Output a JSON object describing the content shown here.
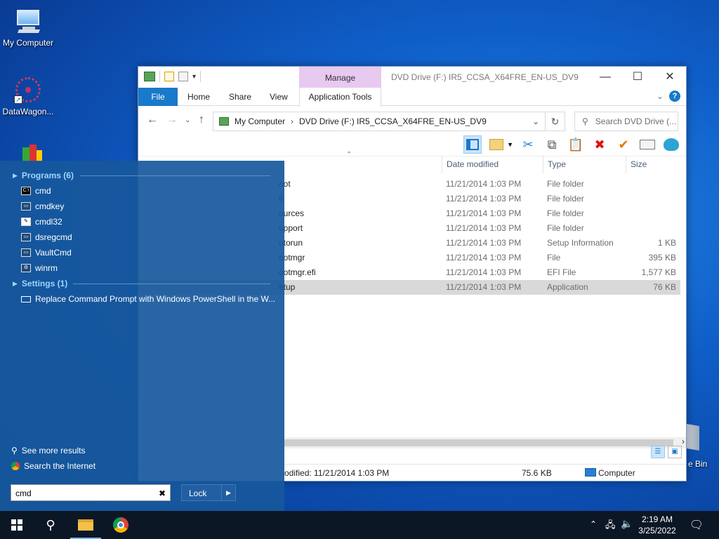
{
  "desktop": {
    "icons": [
      {
        "label": "My Computer"
      },
      {
        "label": "DataWagon..."
      }
    ],
    "recycle_bin_label": "e Bin"
  },
  "explorer": {
    "manage_label": "Manage",
    "title": "DVD Drive (F:) IR5_CCSA_X64FRE_EN-US_DV9",
    "tabs": {
      "file": "File",
      "home": "Home",
      "share": "Share",
      "view": "View",
      "app_tools": "Application Tools"
    },
    "address": {
      "part1": "My Computer",
      "part2": "DVD Drive (F:) IR5_CCSA_X64FRE_EN-US_DV9"
    },
    "search_placeholder": "Search DVD Drive (...",
    "columns": {
      "date": "Date modified",
      "type": "Type",
      "size": "Size"
    },
    "rows": [
      {
        "name": "oot",
        "date": "11/21/2014 1:03 PM",
        "type": "File folder",
        "size": ""
      },
      {
        "name": "fi",
        "date": "11/21/2014 1:03 PM",
        "type": "File folder",
        "size": ""
      },
      {
        "name": "ources",
        "date": "11/21/2014 1:03 PM",
        "type": "File folder",
        "size": ""
      },
      {
        "name": "upport",
        "date": "11/21/2014 1:03 PM",
        "type": "File folder",
        "size": ""
      },
      {
        "name": "utorun",
        "date": "11/21/2014 1:03 PM",
        "type": "Setup Information",
        "size": "1 KB"
      },
      {
        "name": "ootmgr",
        "date": "11/21/2014 1:03 PM",
        "type": "File",
        "size": "395 KB"
      },
      {
        "name": "ootmgr.efi",
        "date": "11/21/2014 1:03 PM",
        "type": "EFI File",
        "size": "1,577 KB"
      },
      {
        "name": "etup",
        "date": "11/21/2014 1:03 PM",
        "type": "Application",
        "size": "76 KB"
      }
    ],
    "status": {
      "modified": "odified: 11/21/2014 1:03 PM",
      "size": "75.6 KB",
      "location": "Computer"
    }
  },
  "startmenu": {
    "programs_header": "Programs (6)",
    "programs": [
      "cmd",
      "cmdkey",
      "cmdl32",
      "dsregcmd",
      "VaultCmd",
      "winrm"
    ],
    "settings_header": "Settings (1)",
    "settings": [
      "Replace Command Prompt with Windows PowerShell in the W..."
    ],
    "see_more": "See more results",
    "search_internet": "Search the Internet",
    "search_value": "cmd",
    "lock_label": "Lock"
  },
  "taskbar": {
    "time": "2:19 AM",
    "date": "3/25/2022"
  }
}
